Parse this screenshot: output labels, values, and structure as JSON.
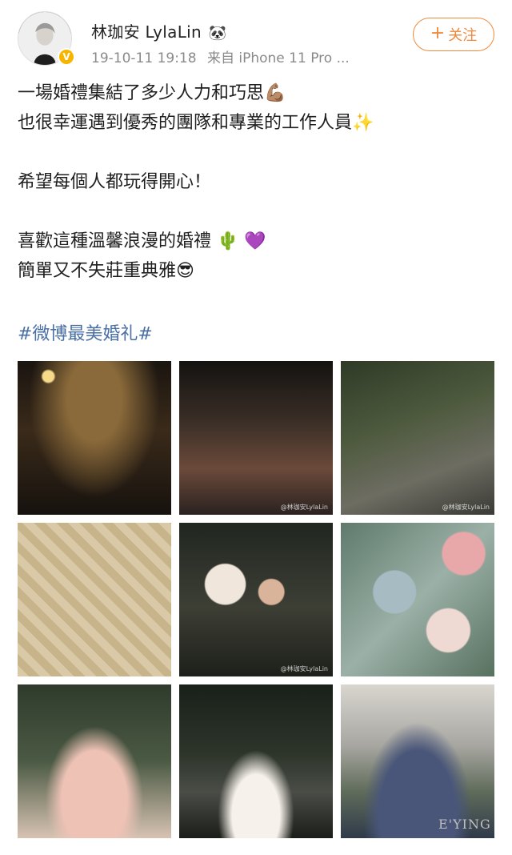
{
  "author": {
    "name": "林珈安 LylaLin",
    "name_emoji": "🐼",
    "verified_badge": "V"
  },
  "post_meta": {
    "time": "19-10-11 19:18",
    "source": "来自 iPhone 11 Pro ..."
  },
  "follow_button": {
    "plus": "+",
    "label": "关注"
  },
  "post": {
    "line1": "一場婚禮集結了多少人力和巧思",
    "line1_emoji": "💪🏽",
    "line2": "也很幸運遇到優秀的團隊和專業的工作人員",
    "line2_emoji": "✨",
    "line3": "希望每個人都玩得開心！",
    "line4": "喜歡這種溫馨浪漫的婚禮",
    "line4_emoji": "🌵 💜",
    "line5": "簡單又不失莊重典雅",
    "line5_emoji": "😎",
    "hashtag": "#微博最美婚礼#"
  },
  "photos": [
    {
      "id": "photo-1",
      "watermark": ""
    },
    {
      "id": "photo-2",
      "watermark": "@林珈安LylaLin"
    },
    {
      "id": "photo-3",
      "watermark": "@林珈安LylaLin"
    },
    {
      "id": "photo-4",
      "watermark": ""
    },
    {
      "id": "photo-5",
      "watermark": "@林珈安LylaLin"
    },
    {
      "id": "photo-6",
      "watermark": ""
    },
    {
      "id": "photo-7",
      "watermark": ""
    },
    {
      "id": "photo-8",
      "watermark": ""
    },
    {
      "id": "photo-9",
      "watermark": ""
    }
  ],
  "corner_logo": "E'YING",
  "colors": {
    "accent_orange": "#f0883a",
    "hashtag_blue": "#4a6fa5",
    "meta_gray": "#8a8a8a",
    "verified_gold": "#f7b500"
  }
}
